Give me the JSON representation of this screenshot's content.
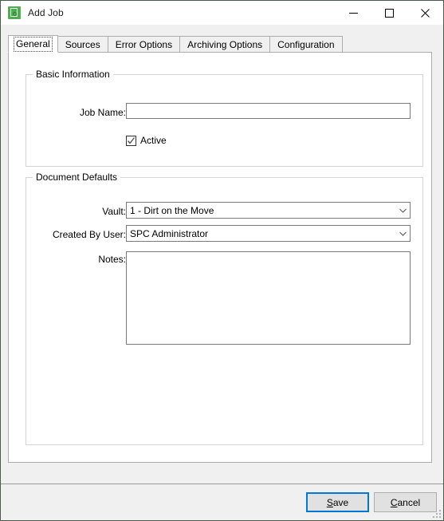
{
  "window": {
    "title": "Add Job",
    "icon": "app-vault-icon",
    "controls": {
      "minimize": "minimize-icon",
      "maximize": "maximize-icon",
      "close": "close-icon"
    }
  },
  "tabs": [
    {
      "label": "General",
      "selected": true
    },
    {
      "label": "Sources",
      "selected": false
    },
    {
      "label": "Error Options",
      "selected": false
    },
    {
      "label": "Archiving Options",
      "selected": false
    },
    {
      "label": "Configuration",
      "selected": false
    }
  ],
  "groups": {
    "basic_information": {
      "label": "Basic Information",
      "job_name": {
        "label": "Job Name:",
        "value": "",
        "placeholder": ""
      },
      "active": {
        "label": "Active",
        "checked": true,
        "check_glyph": "✓"
      }
    },
    "document_defaults": {
      "label": "Document Defaults",
      "vault": {
        "label": "Vault:",
        "value": "1 - Dirt on the Move",
        "arrow": "chevron-down-icon"
      },
      "created_by_user": {
        "label": "Created By User:",
        "value": "SPC  Administrator",
        "arrow": "chevron-down-icon"
      },
      "notes": {
        "label": "Notes:",
        "value": "",
        "placeholder": ""
      }
    }
  },
  "footer": {
    "save": {
      "accel": "S",
      "rest": "ave",
      "default": true
    },
    "cancel": {
      "accel": "C",
      "rest": "ancel",
      "default": false
    }
  },
  "colors": {
    "accent": "#0078d7",
    "icon_green": "#4caf50",
    "window_bg": "#f0f0f0",
    "panel_bg": "#ffffff",
    "border": "#acacac",
    "group_border": "#d4d4d4",
    "field_border": "#7a7a7a"
  }
}
